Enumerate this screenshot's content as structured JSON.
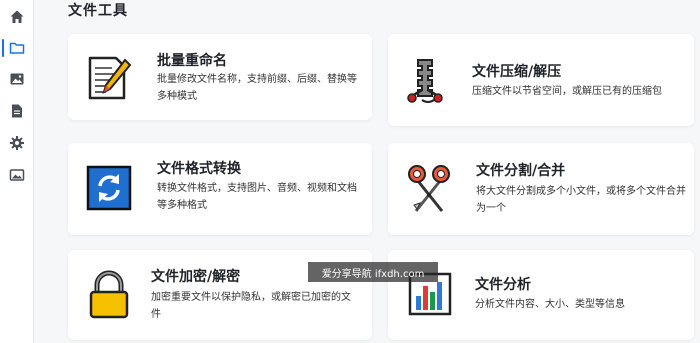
{
  "sidebar": {
    "items": [
      {
        "name": "home",
        "icon": "home-icon",
        "active": false
      },
      {
        "name": "files",
        "icon": "folder-icon",
        "active": true
      },
      {
        "name": "images",
        "icon": "image-icon",
        "active": false
      },
      {
        "name": "documents",
        "icon": "document-icon",
        "active": false
      },
      {
        "name": "settings",
        "icon": "gear-icon",
        "active": false
      },
      {
        "name": "gallery",
        "icon": "picture-icon",
        "active": false
      }
    ],
    "accent": "#1a73e8"
  },
  "main": {
    "section_title": "文件工具",
    "cards": [
      {
        "title": "批量重命名",
        "desc": "批量修改文件名称，支持前缀、后缀、替换等多种模式",
        "icon": "notepad-pencil-icon"
      },
      {
        "title": "文件压缩/解压",
        "desc": "压缩文件以节省空间，或解压已有的压缩包",
        "icon": "archive-zipper-icon"
      },
      {
        "title": "文件格式转换",
        "desc": "转换文件格式，支持图片、音频、视频和文档等多种格式",
        "icon": "convert-arrows-icon"
      },
      {
        "title": "文件分割/合并",
        "desc": "将大文件分割成多个小文件，或将多个文件合并为一个",
        "icon": "scissors-icon"
      },
      {
        "title": "文件加密/解密",
        "desc": "加密重要文件以保护隐私，或解密已加密的文件",
        "icon": "padlock-icon"
      },
      {
        "title": "文件分析",
        "desc": "分析文件内容、大小、类型等信息",
        "icon": "bar-chart-icon"
      }
    ]
  },
  "watermark": {
    "text": "爱分享导航 ifxdh.com"
  }
}
